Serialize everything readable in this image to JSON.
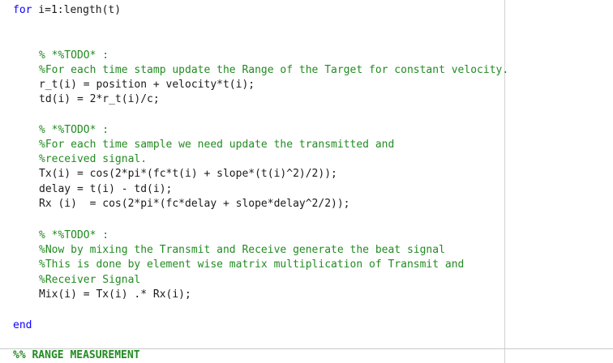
{
  "editor": {
    "for_keyword": "for",
    "for_rest": " i=1:length(t)",
    "end_keyword": "end",
    "block1": {
      "todo": "% *%TODO* :",
      "comment": "%For each time stamp update the Range of the Target for constant velocity.",
      "code1": "r_t(i) = position + velocity*t(i);",
      "code2": "td(i) = 2*r_t(i)/c;"
    },
    "block2": {
      "todo": "% *%TODO* :",
      "comment1": "%For each time sample we need update the transmitted and",
      "comment2": "%received signal.",
      "code1": "Tx(i) = cos(2*pi*(fc*t(i) + slope*(t(i)^2)/2));",
      "code2": "delay = t(i) - td(i);",
      "code3": "Rx (i)  = cos(2*pi*(fc*delay + slope*delay^2/2));"
    },
    "block3": {
      "todo": "% *%TODO* :",
      "comment1": "%Now by mixing the Transmit and Receive generate the beat signal",
      "comment2": "%This is done by element wise matrix multiplication of Transmit and",
      "comment3": "%Receiver Signal",
      "code1": "Mix(i) = Tx(i) .* Rx(i);"
    },
    "section_header": "%% RANGE MEASUREMENT"
  },
  "colors": {
    "keyword": "#0e00ff",
    "comment": "#228b22",
    "code": "#1a1a1a",
    "background": "#ffffff"
  }
}
